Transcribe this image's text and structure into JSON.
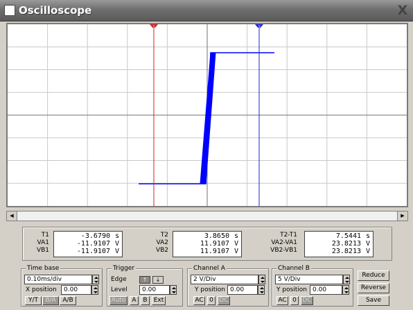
{
  "window": {
    "title": "Oscilloscope",
    "close_glyph": "X"
  },
  "scope": {
    "cursor1": {
      "label": "1",
      "color": "#d62020"
    },
    "cursor2": {
      "label": "2",
      "color": "#2020d6"
    },
    "trace_color": "#0000ff",
    "grid_color": "#c8c8c8",
    "axis_color": "#707070"
  },
  "readout": {
    "t1": {
      "label": "T1",
      "value": "-3.6790",
      "unit": "s"
    },
    "va1": {
      "label": "VA1",
      "value": "-11.9107",
      "unit": "V"
    },
    "vb1": {
      "label": "VB1",
      "value": "-11.9107",
      "unit": "V"
    },
    "t2": {
      "label": "T2",
      "value": "3.8650",
      "unit": "s"
    },
    "va2": {
      "label": "VA2",
      "value": "11.9107",
      "unit": "V"
    },
    "vb2": {
      "label": "VB2",
      "value": "11.9107",
      "unit": "V"
    },
    "dt": {
      "label": "T2-T1",
      "value": "7.5441",
      "unit": "s"
    },
    "dva": {
      "label": "VA2-VA1",
      "value": "23.8213",
      "unit": "V"
    },
    "dvb": {
      "label": "VB2-VB1",
      "value": "23.8213",
      "unit": "V"
    }
  },
  "timebase": {
    "legend": "Time base",
    "value": "0.10ms/div",
    "xpos_label": "X position",
    "xpos_value": "0.00",
    "buttons": {
      "yt": "Y/T",
      "ba": "B/A",
      "ab": "A/B"
    }
  },
  "trigger": {
    "legend": "Trigger",
    "edge_label": "Edge",
    "level_label": "Level",
    "level_value": "0.00",
    "buttons": {
      "auto": "Auto",
      "a": "A",
      "b": "B",
      "ext": "Ext"
    }
  },
  "channel_a": {
    "legend": "Channel A",
    "value": "2  V/Div",
    "ypos_label": "Y position",
    "ypos_value": "0.00",
    "buttons": {
      "ac": "AC",
      "zero": "0",
      "dc": "DC"
    }
  },
  "channel_b": {
    "legend": "Channel B",
    "value": "5  V/Div",
    "ypos_label": "Y position",
    "ypos_value": "0.00",
    "buttons": {
      "ac": "AC",
      "zero": "0",
      "dc": "DC"
    }
  },
  "actions": {
    "reduce": "Reduce",
    "reverse": "Reverse",
    "save": "Save"
  }
}
